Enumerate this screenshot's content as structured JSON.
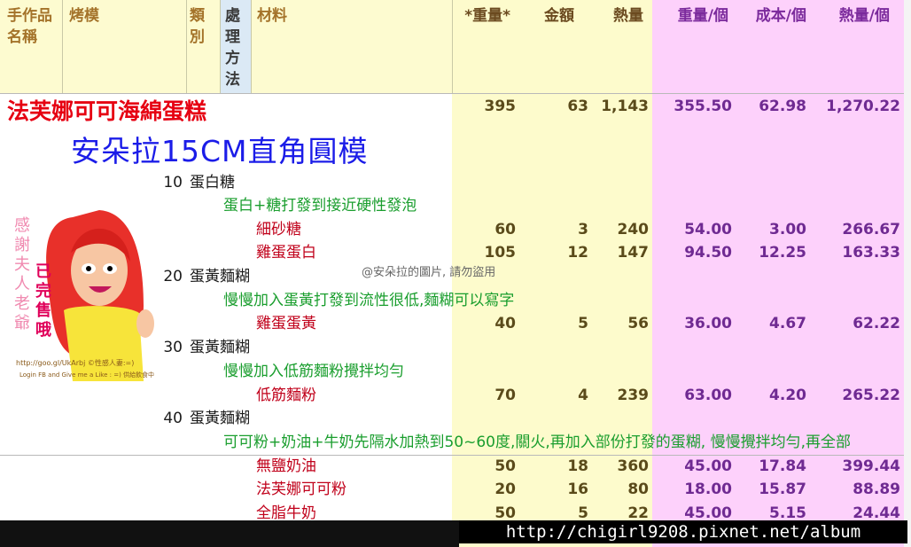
{
  "headers": {
    "name": "手作品名稱",
    "mold": "烤模",
    "category": "類別",
    "method": "處理方法",
    "material": "材料",
    "weight": "*重量*",
    "amount": "金額",
    "calories": "熱量",
    "weight_each": "重量/個",
    "cost_each": "成本/個",
    "calories_each": "熱量/個"
  },
  "product": {
    "name": "法芙娜可可海綿蛋糕",
    "mold": "安朵拉15CM直角圓模",
    "weight": "395",
    "amount": "63",
    "calories": "1,143",
    "weight_each": "355.50",
    "cost_each": "62.98",
    "calories_each": "1,270.22"
  },
  "steps": [
    {
      "code": "10",
      "label": "蛋白糖",
      "note": "蛋白+糖打發到接近硬性發泡"
    },
    {
      "code": "20",
      "label": "蛋黃麵糊",
      "note": "慢慢加入蛋黃打發到流性很低,麵糊可以寫字"
    },
    {
      "code": "30",
      "label": "蛋黃麵糊",
      "note": "慢慢加入低筋麵粉攪拌均勻"
    },
    {
      "code": "40",
      "label": "蛋黃麵糊",
      "note": "可可粉+奶油+牛奶先隔水加熱到50~60度,關火,再加入部份打發的蛋糊, 慢慢攪拌均勻,再全部"
    }
  ],
  "ingredients": [
    {
      "name": "細砂糖",
      "weight": "60",
      "amount": "3",
      "calories": "240",
      "weight_each": "54.00",
      "cost_each": "3.00",
      "calories_each": "266.67"
    },
    {
      "name": "雞蛋蛋白",
      "weight": "105",
      "amount": "12",
      "calories": "147",
      "weight_each": "94.50",
      "cost_each": "12.25",
      "calories_each": "163.33"
    },
    {
      "name": "雞蛋蛋黃",
      "weight": "40",
      "amount": "5",
      "calories": "56",
      "weight_each": "36.00",
      "cost_each": "4.67",
      "calories_each": "62.22"
    },
    {
      "name": "低筋麵粉",
      "weight": "70",
      "amount": "4",
      "calories": "239",
      "weight_each": "63.00",
      "cost_each": "4.20",
      "calories_each": "265.22"
    },
    {
      "name": "無鹽奶油",
      "weight": "50",
      "amount": "18",
      "calories": "360",
      "weight_each": "45.00",
      "cost_each": "17.84",
      "calories_each": "399.44"
    },
    {
      "name": "法芙娜可可粉",
      "weight": "20",
      "amount": "16",
      "calories": "80",
      "weight_each": "18.00",
      "cost_each": "15.87",
      "calories_each": "88.89"
    },
    {
      "name": "全脂牛奶",
      "weight": "50",
      "amount": "5",
      "calories": "22",
      "weight_each": "45.00",
      "cost_each": "5.15",
      "calories_each": "24.44"
    }
  ],
  "watermark": "@安朵拉的圖片, 請勿盜用",
  "badge": {
    "thanks": "感謝夫人老爺",
    "soldout": "已完售哦",
    "credit_line1": "http://goo.gl/UkArbj ©性感人妻:=)",
    "credit_line2": "Login FB and Give me a Like : =) 供給飲食中"
  },
  "footer_url": "http://chigirl9208.pixnet.net/album",
  "colors": {
    "header_fill": "#fdfbd0",
    "pink_fill": "#fdd1fb",
    "title_red": "#e60012",
    "mold_blue": "#1b1ce8",
    "note_green": "#1a9e2e"
  }
}
